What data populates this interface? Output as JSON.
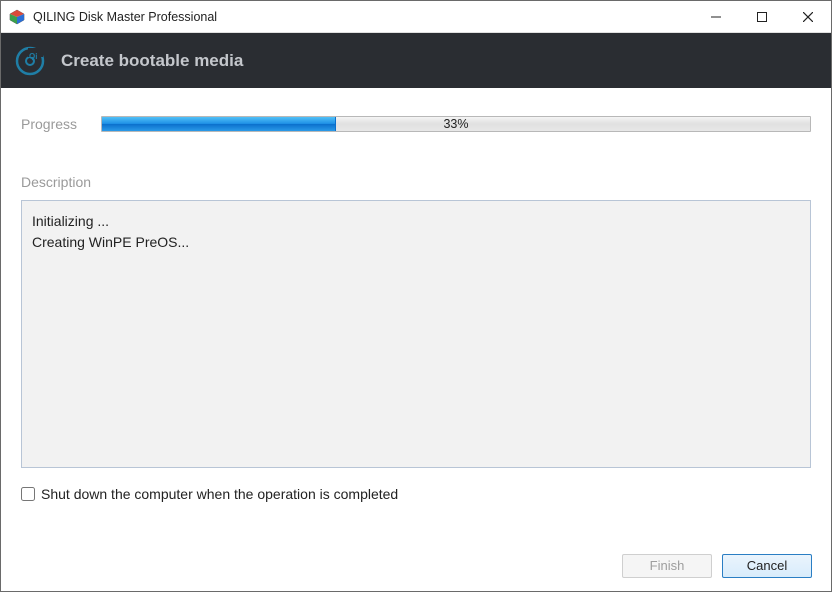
{
  "window": {
    "title": "QILING Disk Master Professional"
  },
  "header": {
    "title": "Create bootable media"
  },
  "progress": {
    "label": "Progress",
    "percent": 33,
    "percent_text": "33%"
  },
  "description": {
    "label": "Description",
    "log": "Initializing ...\nCreating WinPE PreOS..."
  },
  "shutdown": {
    "checked": false,
    "label": "Shut down the computer when the operation is completed"
  },
  "buttons": {
    "finish": "Finish",
    "cancel": "Cancel"
  }
}
